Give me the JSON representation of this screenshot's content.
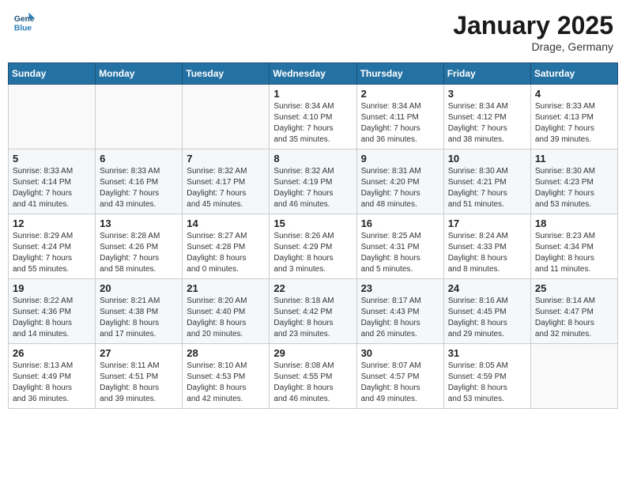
{
  "header": {
    "logo_line1": "General",
    "logo_line2": "Blue",
    "month_title": "January 2025",
    "location": "Drage, Germany"
  },
  "weekdays": [
    "Sunday",
    "Monday",
    "Tuesday",
    "Wednesday",
    "Thursday",
    "Friday",
    "Saturday"
  ],
  "weeks": [
    [
      {
        "day": "",
        "info": ""
      },
      {
        "day": "",
        "info": ""
      },
      {
        "day": "",
        "info": ""
      },
      {
        "day": "1",
        "info": "Sunrise: 8:34 AM\nSunset: 4:10 PM\nDaylight: 7 hours\nand 35 minutes."
      },
      {
        "day": "2",
        "info": "Sunrise: 8:34 AM\nSunset: 4:11 PM\nDaylight: 7 hours\nand 36 minutes."
      },
      {
        "day": "3",
        "info": "Sunrise: 8:34 AM\nSunset: 4:12 PM\nDaylight: 7 hours\nand 38 minutes."
      },
      {
        "day": "4",
        "info": "Sunrise: 8:33 AM\nSunset: 4:13 PM\nDaylight: 7 hours\nand 39 minutes."
      }
    ],
    [
      {
        "day": "5",
        "info": "Sunrise: 8:33 AM\nSunset: 4:14 PM\nDaylight: 7 hours\nand 41 minutes."
      },
      {
        "day": "6",
        "info": "Sunrise: 8:33 AM\nSunset: 4:16 PM\nDaylight: 7 hours\nand 43 minutes."
      },
      {
        "day": "7",
        "info": "Sunrise: 8:32 AM\nSunset: 4:17 PM\nDaylight: 7 hours\nand 45 minutes."
      },
      {
        "day": "8",
        "info": "Sunrise: 8:32 AM\nSunset: 4:19 PM\nDaylight: 7 hours\nand 46 minutes."
      },
      {
        "day": "9",
        "info": "Sunrise: 8:31 AM\nSunset: 4:20 PM\nDaylight: 7 hours\nand 48 minutes."
      },
      {
        "day": "10",
        "info": "Sunrise: 8:30 AM\nSunset: 4:21 PM\nDaylight: 7 hours\nand 51 minutes."
      },
      {
        "day": "11",
        "info": "Sunrise: 8:30 AM\nSunset: 4:23 PM\nDaylight: 7 hours\nand 53 minutes."
      }
    ],
    [
      {
        "day": "12",
        "info": "Sunrise: 8:29 AM\nSunset: 4:24 PM\nDaylight: 7 hours\nand 55 minutes."
      },
      {
        "day": "13",
        "info": "Sunrise: 8:28 AM\nSunset: 4:26 PM\nDaylight: 7 hours\nand 58 minutes."
      },
      {
        "day": "14",
        "info": "Sunrise: 8:27 AM\nSunset: 4:28 PM\nDaylight: 8 hours\nand 0 minutes."
      },
      {
        "day": "15",
        "info": "Sunrise: 8:26 AM\nSunset: 4:29 PM\nDaylight: 8 hours\nand 3 minutes."
      },
      {
        "day": "16",
        "info": "Sunrise: 8:25 AM\nSunset: 4:31 PM\nDaylight: 8 hours\nand 5 minutes."
      },
      {
        "day": "17",
        "info": "Sunrise: 8:24 AM\nSunset: 4:33 PM\nDaylight: 8 hours\nand 8 minutes."
      },
      {
        "day": "18",
        "info": "Sunrise: 8:23 AM\nSunset: 4:34 PM\nDaylight: 8 hours\nand 11 minutes."
      }
    ],
    [
      {
        "day": "19",
        "info": "Sunrise: 8:22 AM\nSunset: 4:36 PM\nDaylight: 8 hours\nand 14 minutes."
      },
      {
        "day": "20",
        "info": "Sunrise: 8:21 AM\nSunset: 4:38 PM\nDaylight: 8 hours\nand 17 minutes."
      },
      {
        "day": "21",
        "info": "Sunrise: 8:20 AM\nSunset: 4:40 PM\nDaylight: 8 hours\nand 20 minutes."
      },
      {
        "day": "22",
        "info": "Sunrise: 8:18 AM\nSunset: 4:42 PM\nDaylight: 8 hours\nand 23 minutes."
      },
      {
        "day": "23",
        "info": "Sunrise: 8:17 AM\nSunset: 4:43 PM\nDaylight: 8 hours\nand 26 minutes."
      },
      {
        "day": "24",
        "info": "Sunrise: 8:16 AM\nSunset: 4:45 PM\nDaylight: 8 hours\nand 29 minutes."
      },
      {
        "day": "25",
        "info": "Sunrise: 8:14 AM\nSunset: 4:47 PM\nDaylight: 8 hours\nand 32 minutes."
      }
    ],
    [
      {
        "day": "26",
        "info": "Sunrise: 8:13 AM\nSunset: 4:49 PM\nDaylight: 8 hours\nand 36 minutes."
      },
      {
        "day": "27",
        "info": "Sunrise: 8:11 AM\nSunset: 4:51 PM\nDaylight: 8 hours\nand 39 minutes."
      },
      {
        "day": "28",
        "info": "Sunrise: 8:10 AM\nSunset: 4:53 PM\nDaylight: 8 hours\nand 42 minutes."
      },
      {
        "day": "29",
        "info": "Sunrise: 8:08 AM\nSunset: 4:55 PM\nDaylight: 8 hours\nand 46 minutes."
      },
      {
        "day": "30",
        "info": "Sunrise: 8:07 AM\nSunset: 4:57 PM\nDaylight: 8 hours\nand 49 minutes."
      },
      {
        "day": "31",
        "info": "Sunrise: 8:05 AM\nSunset: 4:59 PM\nDaylight: 8 hours\nand 53 minutes."
      },
      {
        "day": "",
        "info": ""
      }
    ]
  ]
}
